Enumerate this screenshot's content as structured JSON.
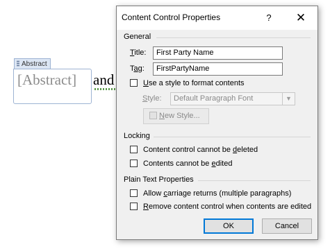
{
  "document": {
    "tag_label": "Abstract",
    "placeholder": "[Abstract]",
    "following_word": "and"
  },
  "dialog": {
    "title": "Content Control Properties",
    "help_label": "?",
    "close_label": "✕",
    "general": {
      "heading": "General",
      "title_label_accel": "T",
      "title_label_rest": "itle:",
      "title_value": "First Party Name",
      "tag_label_prefix": "T",
      "tag_label_accel": "a",
      "tag_label_rest": "g:",
      "tag_value": "FirstPartyName",
      "use_style_accel": "U",
      "use_style_rest": "se a style to format contents",
      "use_style_checked": false,
      "style_label_accel": "S",
      "style_label_rest": "tyle:",
      "style_value": "Default Paragraph Font",
      "new_style_accel": "N",
      "new_style_rest": "ew Style..."
    },
    "locking": {
      "heading": "Locking",
      "cannot_delete_pre": "Content control cannot be ",
      "cannot_delete_accel": "d",
      "cannot_delete_post": "eleted",
      "cannot_delete_checked": false,
      "cannot_edit_pre": "Contents cannot be ",
      "cannot_edit_accel": "e",
      "cannot_edit_post": "dited",
      "cannot_edit_checked": false
    },
    "plain_text": {
      "heading": "Plain Text Properties",
      "carriage_pre": "Allow ",
      "carriage_accel": "c",
      "carriage_post": "arriage returns (multiple paragraphs)",
      "carriage_checked": false,
      "remove_accel": "R",
      "remove_post": "emove content control when contents are edited",
      "remove_checked": false
    },
    "ok_label": "OK",
    "cancel_label": "Cancel"
  }
}
